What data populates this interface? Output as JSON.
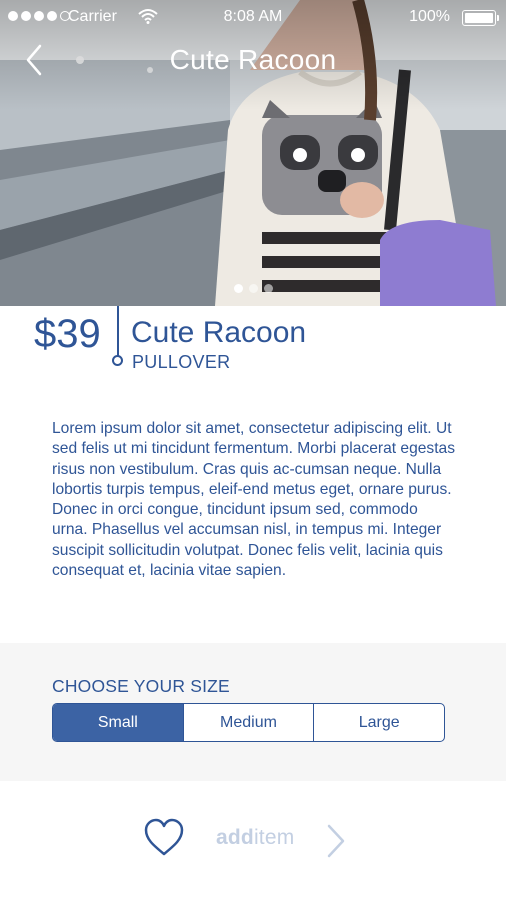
{
  "status_bar": {
    "carrier": "Carrier",
    "time": "8:08 AM",
    "battery": "100%",
    "signal_dots_filled": 4,
    "signal_dots_total": 5
  },
  "nav": {
    "title": "Cute Racoon",
    "back_icon": "chevron-left-icon"
  },
  "gallery": {
    "page_count": 3,
    "active_index": 0
  },
  "product": {
    "price": "$39",
    "name": "Cute Racoon",
    "type": "PULLOVER",
    "description": "Lorem ipsum dolor sit amet, consectetur adipiscing elit. Ut sed felis ut mi tincidunt fermentum. Morbi placerat egestas risus non vestibulum. Cras quis ac-cumsan neque. Nulla lobortis turpis tempus, eleif-end metus eget, ornare purus. Donec in orci congue, tincidunt ipsum sed, commodo urna. Phasellus vel accumsan nisl, in tempus mi. Integer suscipit sollicitudin volutpat. Donec felis velit, lacinia quis consequat et, lacinia vitae sapien."
  },
  "size": {
    "heading": "CHOOSE YOUR SIZE",
    "options": [
      "Small",
      "Medium",
      "Large"
    ],
    "selected": "Small"
  },
  "footer": {
    "favorite_icon": "heart-icon",
    "add_label_bold": "add",
    "add_label_light": "item",
    "arrow_icon": "chevron-right-icon"
  },
  "colors": {
    "accent": "#2f5596",
    "selected_fill": "#3c63a4",
    "muted": "#c3cfe2",
    "panel_bg": "#f6f6f6"
  }
}
